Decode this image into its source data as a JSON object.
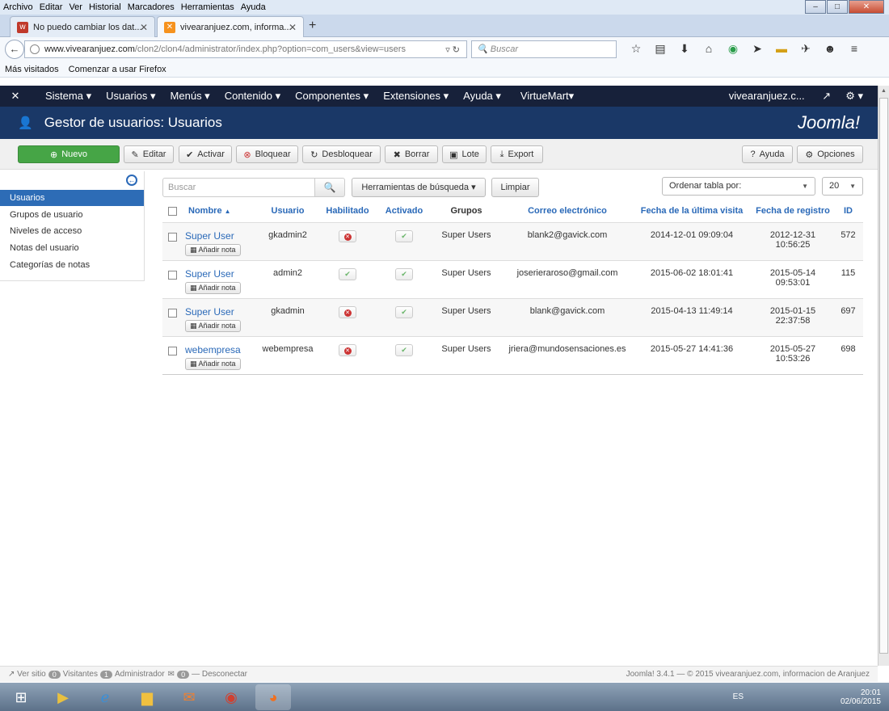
{
  "browser": {
    "menu": [
      "Archivo",
      "Editar",
      "Ver",
      "Historial",
      "Marcadores",
      "Herramientas",
      "Ayuda"
    ],
    "tabs": [
      {
        "title": "No puedo cambiar los dat..."
      },
      {
        "title": "vivearanjuez.com, informa..."
      }
    ],
    "url_domain": "www.vivearanjuez.com",
    "url_path": "/clon2/clon4/administrator/index.php?option=com_users&view=users",
    "search_placeholder": "Buscar",
    "bookmarks": [
      "Más visitados",
      "Comenzar a usar Firefox"
    ]
  },
  "joomla": {
    "topmenu": [
      "Sistema ▾",
      "Usuarios ▾",
      "Menús ▾",
      "Contenido ▾",
      "Componentes ▾",
      "Extensiones ▾",
      "Ayuda ▾",
      "VirtueMart▾"
    ],
    "site_link": "vivearanjuez.c...",
    "page_title": "Gestor de usuarios: Usuarios",
    "logo": "Joomla!",
    "toolbar": {
      "new": "Nuevo",
      "edit": "Editar",
      "activate": "Activar",
      "block": "Bloquear",
      "unblock": "Desbloquear",
      "delete": "Borrar",
      "batch": "Lote",
      "export": "Export",
      "help": "Ayuda",
      "options": "Opciones"
    },
    "sidebar": [
      "Usuarios",
      "Grupos de usuario",
      "Niveles de acceso",
      "Notas del usuario",
      "Categorías de notas"
    ],
    "filters": {
      "search_placeholder": "Buscar",
      "search_tools": "Herramientas de búsqueda",
      "clear": "Limpiar",
      "sort": "Ordenar tabla por:",
      "limit": "20"
    },
    "columns": [
      "Nombre",
      "Usuario",
      "Habilitado",
      "Activado",
      "Grupos",
      "Correo electrónico",
      "Fecha de la última visita",
      "Fecha de registro",
      "ID"
    ],
    "sort_arrow": "▲",
    "add_note": "Añadir nota",
    "users": [
      {
        "name": "Super User",
        "username": "gkadmin2",
        "enabled": false,
        "activated": true,
        "groups": "Super Users",
        "email": "blank2@gavick.com",
        "last_visit": "2014-12-01 09:09:04",
        "reg_date": "2012-12-31",
        "reg_time": "10:56:25",
        "id": "572"
      },
      {
        "name": "Super User",
        "username": "admin2",
        "enabled": true,
        "activated": true,
        "groups": "Super Users",
        "email": "joserieraroso@gmail.com",
        "last_visit": "2015-06-02 18:01:41",
        "reg_date": "2015-05-14",
        "reg_time": "09:53:01",
        "id": "115"
      },
      {
        "name": "Super User",
        "username": "gkadmin",
        "enabled": false,
        "activated": true,
        "groups": "Super Users",
        "email": "blank@gavick.com",
        "last_visit": "2015-04-13 11:49:14",
        "reg_date": "2015-01-15",
        "reg_time": "22:37:58",
        "id": "697"
      },
      {
        "name": "webempresa",
        "username": "webempresa",
        "enabled": false,
        "activated": true,
        "groups": "Super Users",
        "email": "jriera@mundosensaciones.es",
        "last_visit": "2015-05-27 14:41:36",
        "reg_date": "2015-05-27",
        "reg_time": "10:53:26",
        "id": "698"
      }
    ],
    "status": {
      "view_site": "Ver sitio",
      "visitors_count": "0",
      "visitors": "Visitantes",
      "admin_count": "1",
      "admin": "Administrador",
      "messages_count": "0",
      "logout": "Desconectar",
      "footer": "Joomla! 3.4.1 — © 2015 vivearanjuez.com, informacion de Aranjuez"
    }
  },
  "taskbar": {
    "lang": "ES",
    "time": "20:01",
    "date": "02/06/2015"
  }
}
